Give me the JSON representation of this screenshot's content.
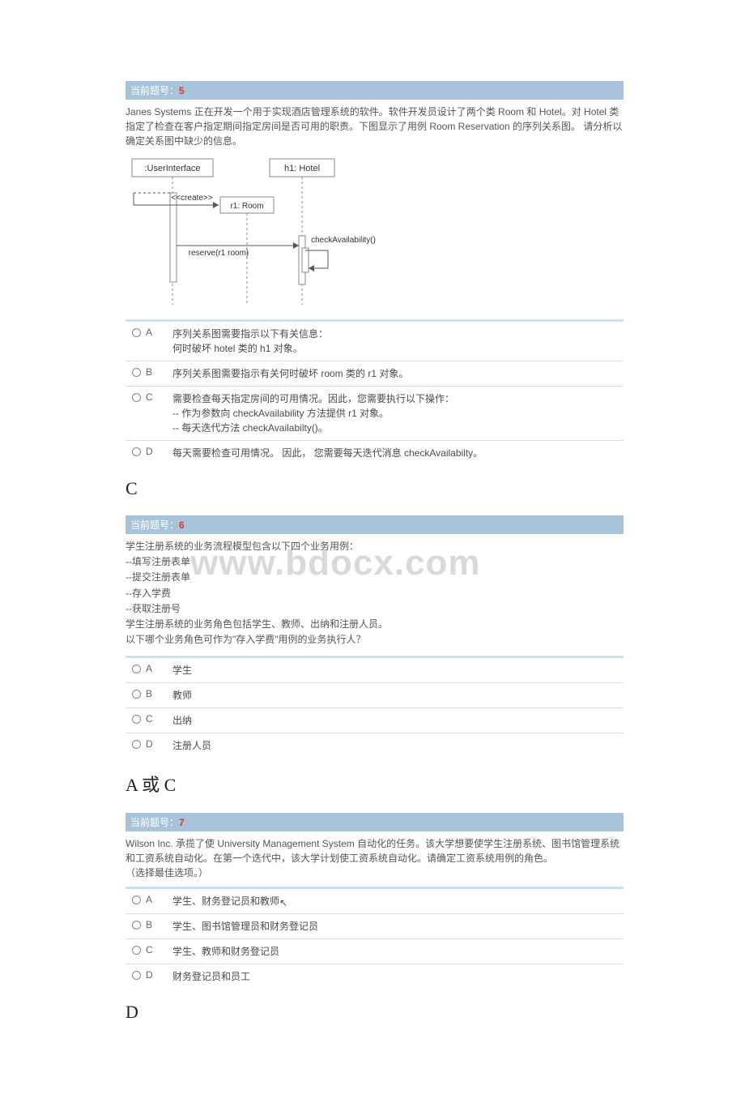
{
  "watermark": "www.bdocx.com",
  "q5": {
    "header_prefix": "当前题号：",
    "header_num": "5",
    "text": "Janes Systems 正在开发一个用于实现酒店管理系统的软件。软件开发员设计了两个类 Room 和 Hotel。对 Hotel 类指定了检查在客户指定期间指定房间是否可用的职责。下图显示了用例 Room Reservation 的序列关系图。 请分析以确定关系图中缺少的信息。",
    "diagram": {
      "obj1": ":UserInterface",
      "obj2": "h1: Hotel",
      "create": "<<create>>",
      "create_target": "r1: Room",
      "msg1": "reserve(r1 room)",
      "msg2": "checkAvailability()"
    },
    "options": {
      "A": "序列关系图需要指示以下有关信息：\n何时破坏 hotel 类的 h1 对象。",
      "B": "序列关系图需要指示有关何时破坏 room 类的 r1 对象。",
      "C": "需要检查每天指定房间的可用情况。因此，您需要执行以下操作：\n-- 作为参数向 checkAvailability 方法提供 r1 对象。\n-- 每天迭代方法 checkAvailabilty()。",
      "D": "每天需要检查可用情况。 因此， 您需要每天迭代消息 checkAvailabilty。"
    },
    "answer": "C"
  },
  "q6": {
    "header_prefix": "当前题号：",
    "header_num": "6",
    "text": "学生注册系统的业务流程模型包含以下四个业务用例：\n--填写注册表单\n--提交注册表单\n--存入学费\n--获取注册号\n学生注册系统的业务角色包括学生、教师、出纳和注册人员。\n以下哪个业务角色可作为\"存入学费\"用例的业务执行人？",
    "options": {
      "A": "学生",
      "B": "教师",
      "C": "出纳",
      "D": "注册人员"
    },
    "answer": "A 或 C"
  },
  "q7": {
    "header_prefix": "当前题号：",
    "header_num": "7",
    "text": "Wilson Inc. 承揽了使 University Management System 自动化的任务。该大学想要使学生注册系统、图书馆管理系统和工资系统自动化。在第一个迭代中，该大学计划使工资系统自动化。请确定工资系统用例的角色。\n（选择最佳选项。）",
    "options": {
      "A": "学生、财务登记员和教师",
      "B": "学生、图书馆管理员和财务登记员",
      "C": "学生、教师和财务登记员",
      "D": "财务登记员和员工"
    },
    "answer": "D"
  }
}
